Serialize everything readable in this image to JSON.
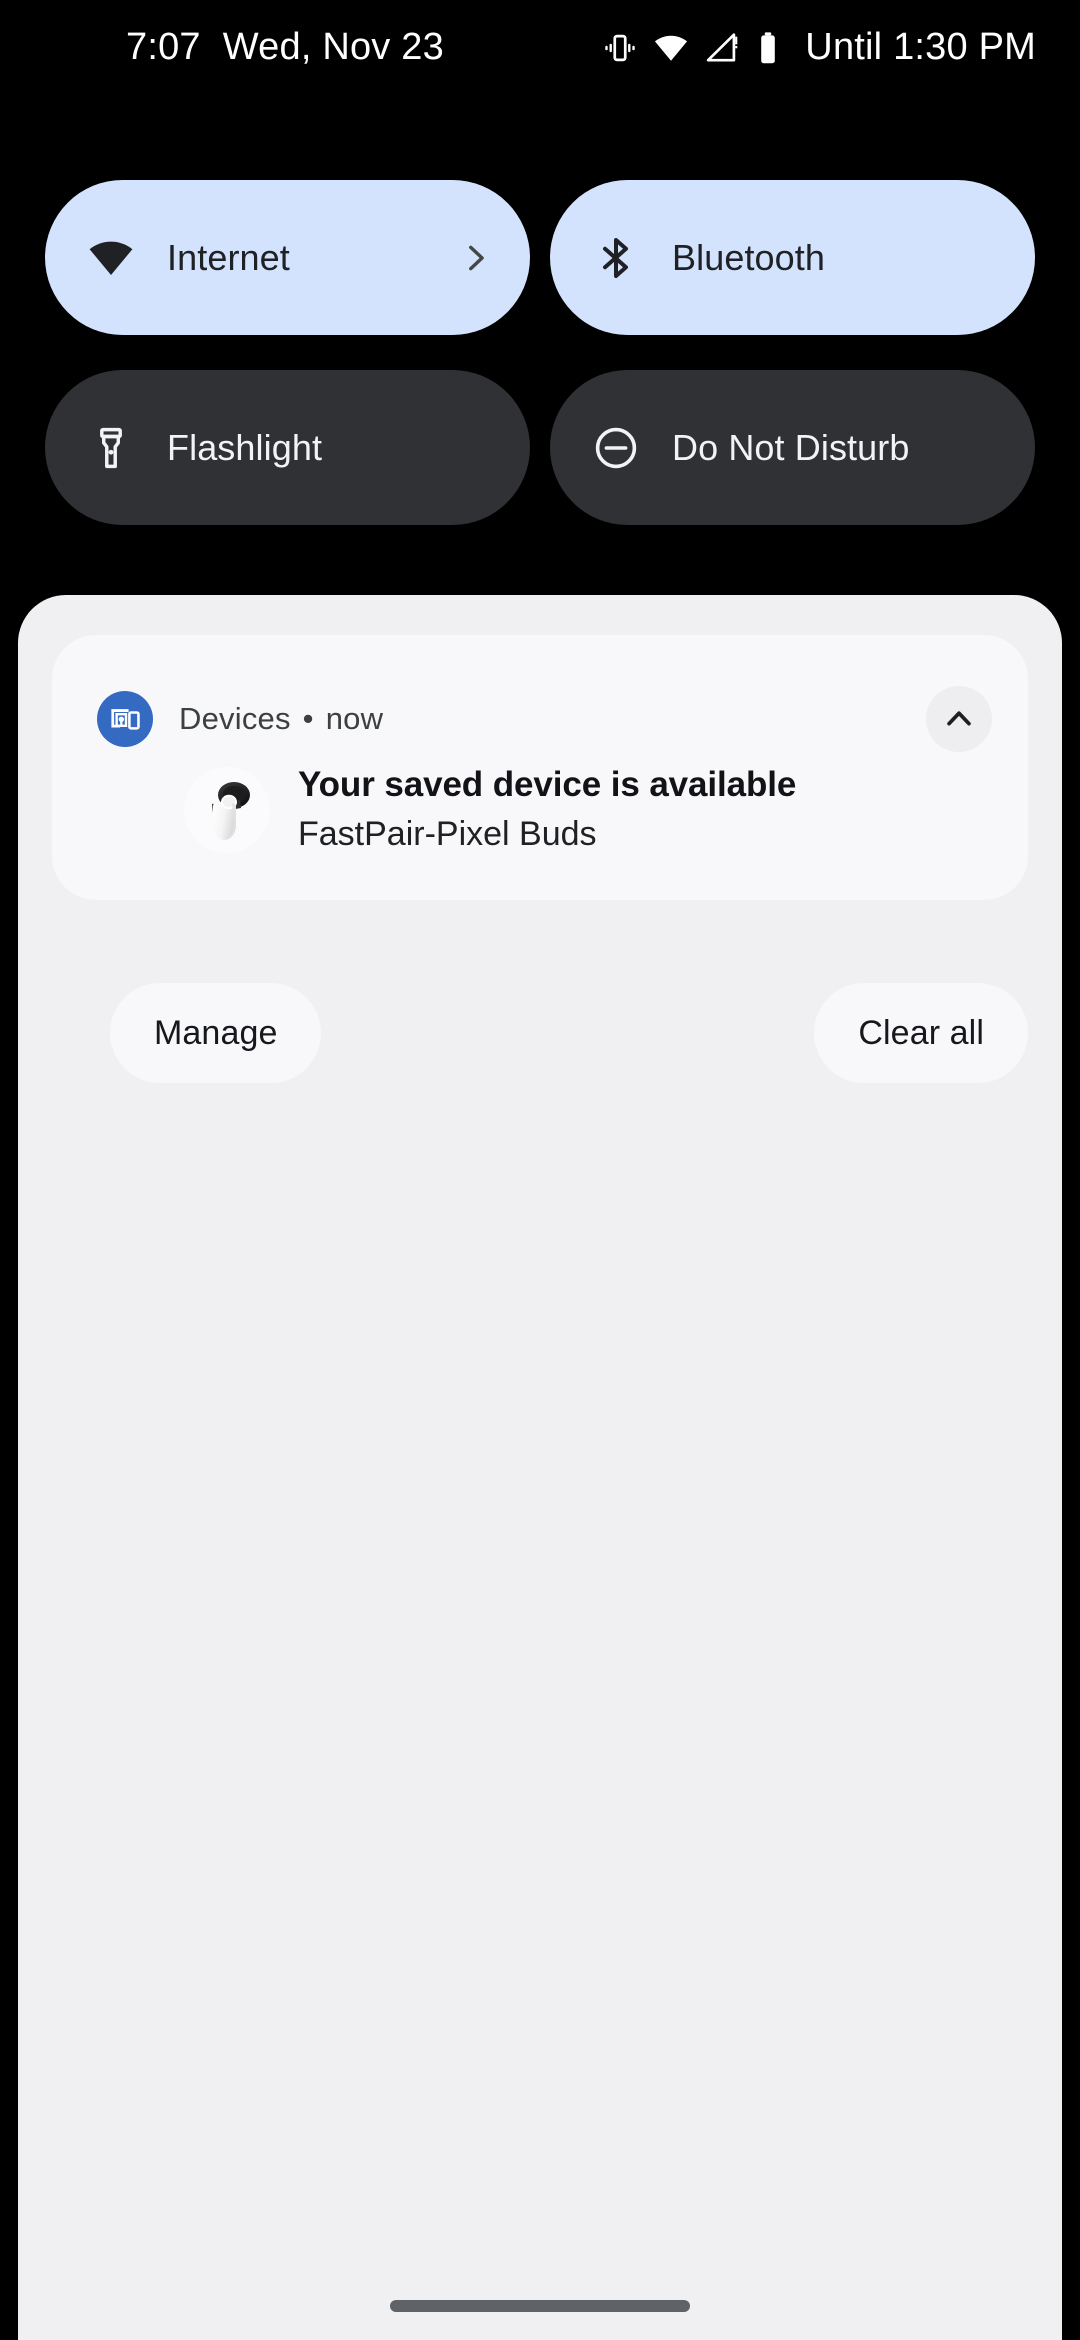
{
  "status_bar": {
    "time": "7:07",
    "date": "Wed, Nov 23",
    "icons": [
      "vibrate-icon",
      "wifi-icon",
      "no-sim-signal-icon",
      "battery-icon"
    ],
    "battery_estimate": "Until 1:30 PM"
  },
  "quick_settings": {
    "tiles": [
      {
        "label": "Internet",
        "icon": "wifi-icon",
        "state": "on",
        "has_chevron": true,
        "bg": "#d3e3fd",
        "fg": "#202124"
      },
      {
        "label": "Bluetooth",
        "icon": "bluetooth-icon",
        "state": "on",
        "has_chevron": false,
        "bg": "#d3e3fd",
        "fg": "#202124"
      },
      {
        "label": "Flashlight",
        "icon": "flashlight-icon",
        "state": "off",
        "has_chevron": false,
        "bg": "#303134",
        "fg": "#f1f3f4"
      },
      {
        "label": "Do Not Disturb",
        "icon": "dnd-icon",
        "state": "off",
        "has_chevron": false,
        "bg": "#303134",
        "fg": "#f1f3f4"
      }
    ]
  },
  "shade": {
    "background": "#f0f0f2",
    "notification": {
      "app_name": "Devices",
      "separator": "•",
      "time": "now",
      "app_icon": "devices-icon",
      "app_icon_color": "#356ac3",
      "collapse_icon": "chevron-up-icon",
      "device_image": "pixel-buds-case-image",
      "title": "Your saved device is available",
      "subtitle": "FastPair-Pixel Buds",
      "card_background": "#f8f8fa"
    },
    "footer": {
      "manage_label": "Manage",
      "clear_all_label": "Clear all"
    }
  },
  "nav_bar": {
    "gesture_pill": "home-gesture-pill",
    "pill_color": "#5f6368"
  }
}
